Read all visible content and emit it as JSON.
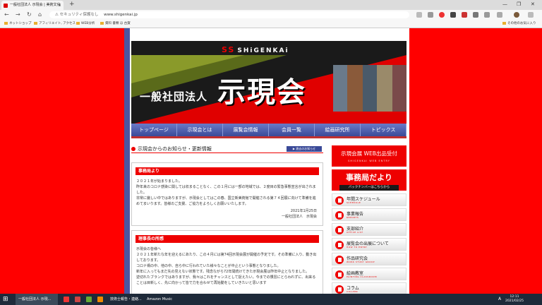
{
  "browser": {
    "tab_title": "一般社団法人 示現会 | 美術文化",
    "tab_close": "×",
    "new_tab": "+",
    "window_controls": [
      "—",
      "❐",
      "✕"
    ],
    "nav": [
      "←",
      "→",
      "↻",
      "⌂"
    ],
    "security_label": "⚠ セキュリティ保護なし",
    "url": "www.shigenkai.jp",
    "bookmarks": [
      "ネットショップ",
      "アフィリエイト, アクセス",
      "WEB分析",
      "資料 書類 ほ 古賀"
    ],
    "other_bookmarks": "その他のお気に入り"
  },
  "header": {
    "brand_mark": "SS",
    "brand": "SHiGENKAi",
    "org_type": "一般社団法人",
    "logo": "示現会"
  },
  "menu": [
    "トップページ",
    "示現会とは",
    "展覧会情報",
    "会員一覧",
    "絵画研究所",
    "トピックス"
  ],
  "main": {
    "section_title": "示現会からのお知らせ・更新情報",
    "more_button": "▶ 過去のお知らせ",
    "notices": [
      {
        "heading": "事務局より",
        "lines": [
          "２０２１年が始まりました。",
          "昨年来のコロナ感染に関しては収まることなく、この１月には一部の地域では、２度目の緊急事態宣言が出されました。",
          "非常に厳しい中ではありますが、示現会としてはこの春、国立新美術館で開催される第７４回展に向けて準備を進めてまいります。皆様のご支援、ご協力をよろしくお願いいたします。"
        ],
        "date": "2021年1月25日",
        "sign": "一般社団法人　示現会"
      },
      {
        "heading": "理事長の所感",
        "lines": [
          "示現会の皆様へ",
          "２０２１年新たな年を迎えるにあたり、この４月には第74回示現会展が開催の予定です。その準備に入り、動き出しております。",
          "コロナ禍の中、他の中、自ら中に行われていた様々なことが中止という事態となりました。",
          "新年に入ってもまだ先の見えない状態です。残念ながら72年間続けてきた示現会展は昨年中止となりました。",
          "逆切れたブランクではありますが、我々はこれをチャンスとして捉えたい。今までの慣習にとらわれずに、出来ることは目新しく、先に向かって皆で力を合わせて再始動をしていきたいと思います"
        ]
      }
    ]
  },
  "sidebar": {
    "banner1_title": "示現会展 WEB出品受付",
    "banner1_sub": "SHIGENKAI WEB ENTRY",
    "banner2_title": "事務局だより",
    "banner2_sub": "バックナンバーはこちらから",
    "items": [
      {
        "label": "年間スケジュール",
        "sub": "SCHEDULE"
      },
      {
        "label": "事業報告",
        "sub": "REPORTS"
      },
      {
        "label": "支部紹介",
        "sub": "OFFICE LIST"
      },
      {
        "label": "展覧会の出展について",
        "sub": "HOW TO ENTRY"
      },
      {
        "label": "作品研究会",
        "sub": "WORK STUDY GROUP"
      },
      {
        "label": "絵画教室",
        "sub": "PAINTING CLASSROOM"
      },
      {
        "label": "コラム",
        "sub": "COLUMN"
      }
    ]
  },
  "taskbar": {
    "start": "⊞",
    "apps": [
      "一般社団法人 示現...",
      "",
      "",
      "",
      "",
      "技術士報告・連絡...",
      "Amazon Music"
    ],
    "ime": "A",
    "time": "12:11",
    "date": "2021/02/25"
  },
  "colors": {
    "page_bg": "#ff0000",
    "accent": "#e00000",
    "nav_blue": "#3a4a98"
  }
}
